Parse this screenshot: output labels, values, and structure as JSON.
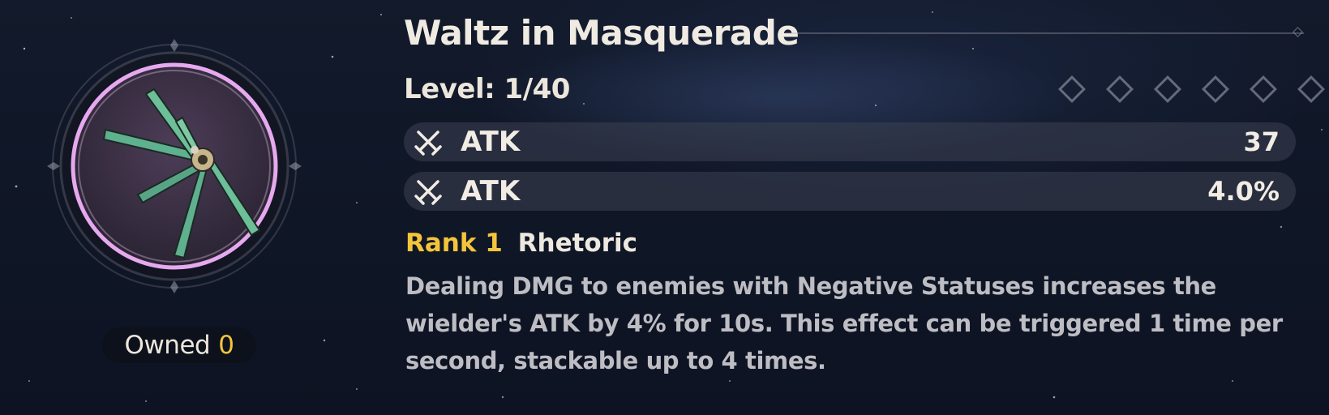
{
  "item": {
    "name": "Waltz in Masquerade",
    "level": "Level: 1/40",
    "rank_slots": 6,
    "owned_label": "Owned",
    "owned_count": "0"
  },
  "stats": [
    {
      "name": "ATK",
      "value": "37",
      "icon": "crossed-swords-icon"
    },
    {
      "name": "ATK",
      "value": "4.0%",
      "icon": "crossed-swords-icon"
    }
  ],
  "passive": {
    "rank_label": "Rank 1",
    "name": "Rhetoric",
    "description": "Dealing DMG to enemies with Negative Statuses increases the wielder's ATK by 4% for 10s. This effect can be triggered 1 time per second, stackable up to 4 times."
  },
  "colors": {
    "accent_gold": "#f4c53b",
    "ring_pink": "#e6a9ef",
    "background": "#121a2b"
  }
}
